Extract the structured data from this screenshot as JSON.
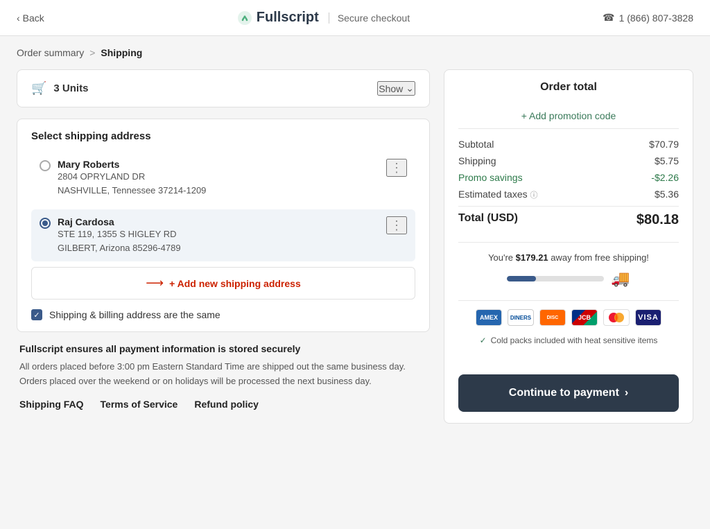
{
  "topbar": {
    "back_label": "Back",
    "logo_text": "Fullscript",
    "secure_label": "Secure checkout",
    "phone": "1 (866) 807-3828"
  },
  "breadcrumb": {
    "step1": "Order summary",
    "separator": ">",
    "step2": "Shipping"
  },
  "units_card": {
    "count": "3 Units",
    "show_label": "Show"
  },
  "address_section": {
    "title": "Select shipping address",
    "addresses": [
      {
        "name": "Mary Roberts",
        "line1": "2804 OPRYLAND DR",
        "line2": "NASHVILLE, Tennessee 37214-1209",
        "selected": false
      },
      {
        "name": "Raj Cardosa",
        "line1": "STE 119, 1355 S HIGLEY RD",
        "line2": "GILBERT, Arizona 85296-4789",
        "selected": true
      }
    ],
    "add_btn_label": "+ Add new shipping address",
    "checkbox_label": "Shipping & billing address are the same"
  },
  "security_section": {
    "title": "Fullscript ensures all payment information is stored securely",
    "description": "All orders placed before 3:00 pm Eastern Standard Time are shipped out the same business day. Orders placed over the weekend or on holidays will be processed the next business day.",
    "link1": "Shipping FAQ",
    "link2": "Terms of Service",
    "link3": "Refund policy"
  },
  "order_total": {
    "title": "Order total",
    "promo_label": "+ Add promotion code",
    "subtotal_label": "Subtotal",
    "subtotal_value": "$70.79",
    "shipping_label": "Shipping",
    "shipping_value": "$5.75",
    "promo_savings_label": "Promo savings",
    "promo_savings_value": "-$2.26",
    "taxes_label": "Estimated taxes",
    "taxes_value": "$5.36",
    "total_label": "Total (USD)",
    "total_value": "$80.18",
    "free_shipping_text": "You're",
    "free_shipping_amount": "$179.21",
    "free_shipping_suffix": "away from free shipping!",
    "cold_packs_label": "Cold packs included with heat sensitive items",
    "continue_label": "Continue to payment"
  }
}
